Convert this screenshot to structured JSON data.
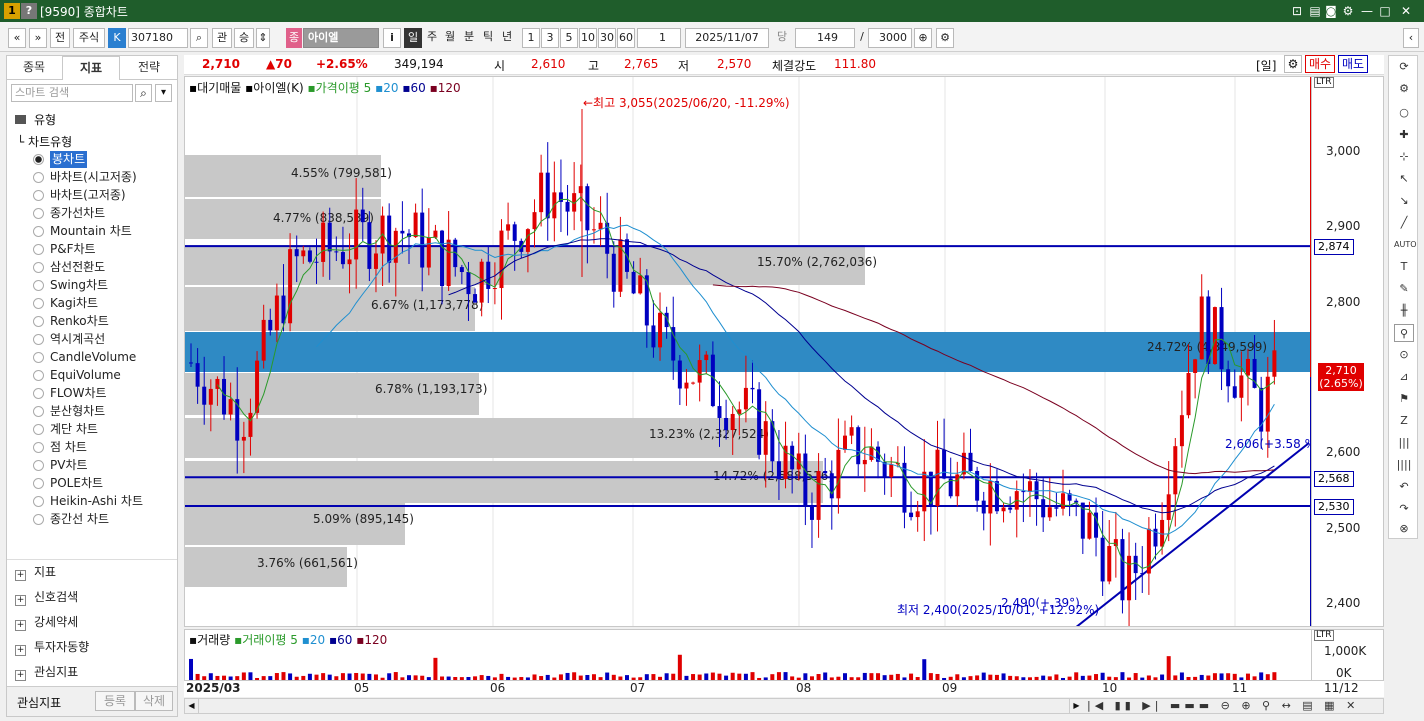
{
  "window": {
    "title": "[9590] 종합차트",
    "icon1": "1",
    "icon2": "?"
  },
  "toolbar": {
    "nav_prev": "«",
    "nav_down": "»",
    "jeon": "전",
    "market": "주식",
    "k": "K",
    "code": "307180",
    "gwan": "관",
    "seung": "승",
    "jong_badge": "종",
    "stock_name": "아이엘",
    "info": "i",
    "periods": [
      "일",
      "주",
      "월",
      "분",
      "틱",
      "년"
    ],
    "intervals": [
      "1",
      "3",
      "5",
      "10",
      "30",
      "60"
    ],
    "interval_value": "1",
    "date": "2025/11/07",
    "dang": "당",
    "count": "149",
    "slash": "/",
    "max_count": "3000"
  },
  "left": {
    "tabs": [
      "종목",
      "지표",
      "전략"
    ],
    "active_tab": "지표",
    "search_placeholder": "스마트 검색",
    "section": "유형",
    "group": "차트유형",
    "chart_types": [
      "봉차트",
      "바차트(시고저종)",
      "바차트(고저종)",
      "종가선차트",
      "Mountain 차트",
      "P&F차트",
      "삼선전환도",
      "Swing차트",
      "Kagi차트",
      "Renko차트",
      "역시계곡선",
      "CandleVolume",
      "EquiVolume",
      "FLOW차트",
      "분산형차트",
      "계단 차트",
      "점 차트",
      "PV차트",
      "POLE차트",
      "Heikin-Ashi 차트",
      "종간선 차트"
    ],
    "selected_type": "봉차트",
    "folders": [
      "지표",
      "신호검색",
      "강세약세",
      "투자자동향",
      "관심지표"
    ],
    "footer_label": "관심지표",
    "register": "등록",
    "delete": "삭제"
  },
  "info": {
    "price": "2,710",
    "change": "▲70",
    "change_pct": "+2.65%",
    "volume": "349,194",
    "open_label": "시",
    "open": "2,610",
    "high_label": "고",
    "high": "2,765",
    "low_label": "저",
    "low": "2,570",
    "strength_label": "체결강도",
    "strength": "111.80",
    "period_tag": "[일]",
    "buy": "매수",
    "sell": "매도"
  },
  "legend": {
    "items": [
      "대기매물",
      "아이엘(K)",
      "가격이평 5",
      "20",
      "60",
      "120"
    ]
  },
  "annotations": {
    "max": "←최고 3,055(2025/06/20, -11.29%)",
    "min": "최저 2,400(2025/10/01, +12.92%)",
    "trend": "2,490(+,39°)",
    "ma": "2,606(+3.58 %)"
  },
  "profile": [
    {
      "label": "4.55% (799,581)"
    },
    {
      "label": "4.77% (838,539)"
    },
    {
      "label": "15.70% (2,762,036)"
    },
    {
      "label": "6.67% (1,173,778)"
    },
    {
      "label": "24.72% (4,349,599)"
    },
    {
      "label": "6.78% (1,193,173)"
    },
    {
      "label": "13.23% (2,327,524)"
    },
    {
      "label": "14.72% (2,588,516)"
    },
    {
      "label": "5.09% (895,145)"
    },
    {
      "label": "3.76% (661,561)"
    }
  ],
  "yaxis": {
    "ticks": [
      "3,000",
      "2,900",
      "2,800",
      "2,600",
      "2,500",
      "2,400"
    ],
    "boxes": [
      "2,874",
      "2,568",
      "2,530"
    ],
    "current": "2,710",
    "current_pct": "(2.65%)"
  },
  "volume": {
    "legend": [
      "거래량",
      "거래이평 5",
      "20",
      "60",
      "120"
    ],
    "ticks": [
      "1,000K",
      "0K"
    ]
  },
  "xaxis": {
    "labels": [
      "2025/03",
      "05",
      "06",
      "07",
      "08",
      "09",
      "10",
      "11",
      "11/12"
    ]
  },
  "colors": {
    "up": "#e00000",
    "down": "#0000c0",
    "ma5": "#2a9a2a",
    "ma20": "#1f8fd0",
    "ma60": "#000090",
    "ma120": "#7a0020",
    "band": "#2f8ac4",
    "profile": "#c8c8c8"
  }
}
